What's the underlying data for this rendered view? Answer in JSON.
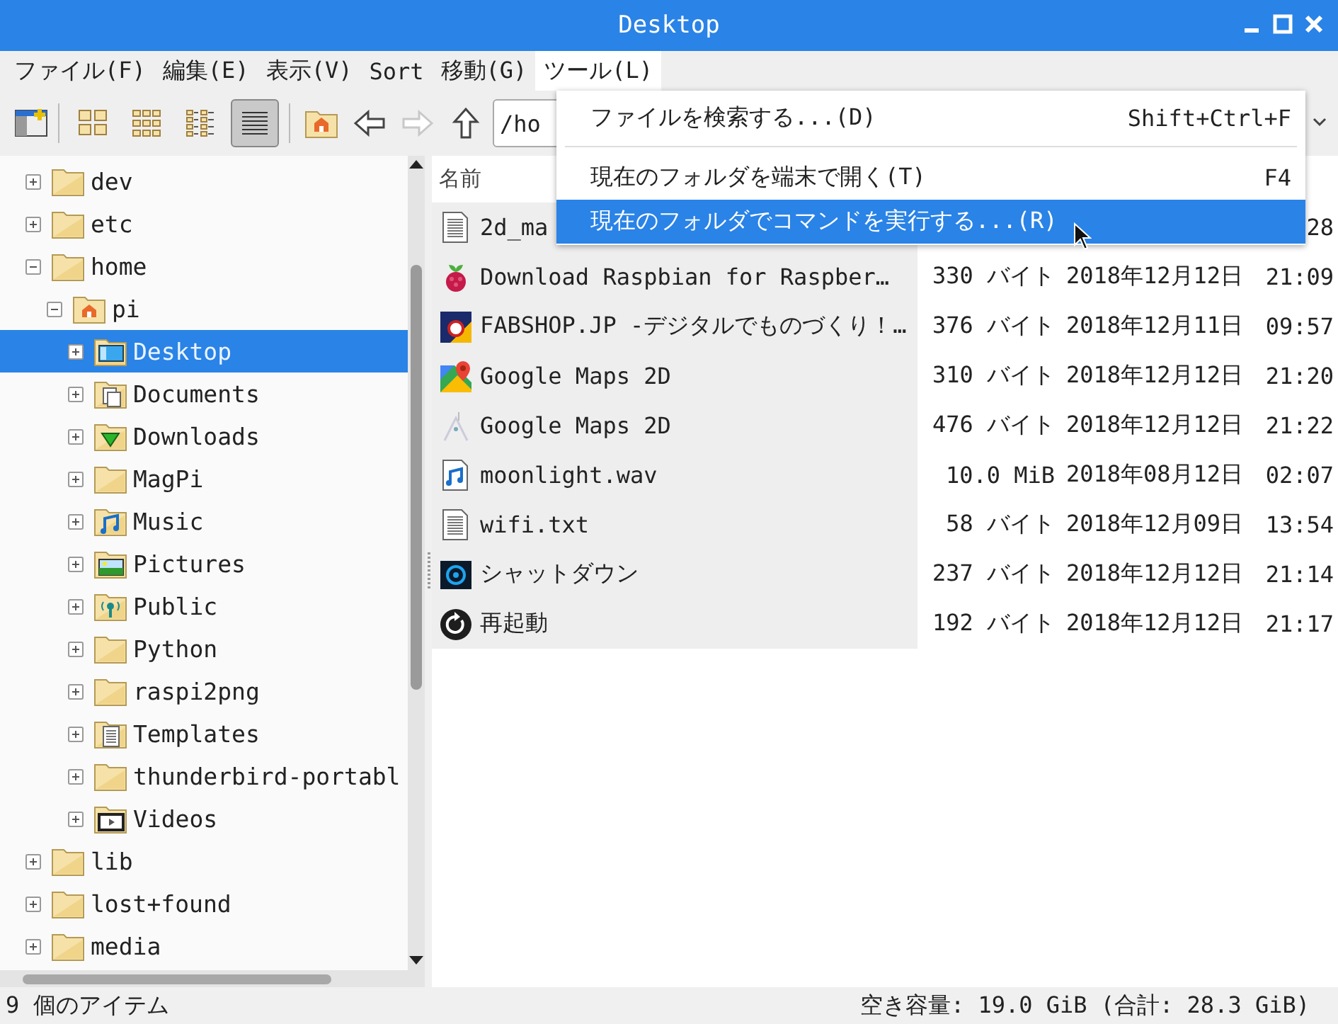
{
  "window": {
    "title": "Desktop"
  },
  "menubar": [
    {
      "label": "ファイル(F)",
      "open": false
    },
    {
      "label": "編集(E)",
      "open": false
    },
    {
      "label": "表示(V)",
      "open": false
    },
    {
      "label": "Sort",
      "open": false
    },
    {
      "label": "移動(G)",
      "open": false
    },
    {
      "label": "ツール(L)",
      "open": true
    }
  ],
  "toolbar": {
    "view_buttons": [
      {
        "kind": "icons",
        "selected": false
      },
      {
        "kind": "thumbnails",
        "selected": false
      },
      {
        "kind": "compact",
        "selected": false
      },
      {
        "kind": "list",
        "selected": true
      }
    ],
    "nav_buttons": [
      {
        "kind": "home",
        "disabled": false
      },
      {
        "kind": "back",
        "disabled": false
      },
      {
        "kind": "forward",
        "disabled": true
      },
      {
        "kind": "up",
        "disabled": false
      }
    ],
    "path": "/ho"
  },
  "sidebar": {
    "tree": [
      {
        "name": "dev",
        "kind": "folder",
        "expanded": false,
        "selected": false
      },
      {
        "name": "etc",
        "kind": "folder",
        "expanded": false,
        "selected": false
      },
      {
        "name": "home",
        "kind": "folder",
        "expanded": true,
        "selected": false,
        "children": [
          {
            "name": "pi",
            "kind": "home",
            "expanded": true,
            "selected": false,
            "children": [
              {
                "name": "Desktop",
                "kind": "desktop",
                "expanded": false,
                "selected": true
              },
              {
                "name": "Documents",
                "kind": "documents",
                "expanded": false,
                "selected": false
              },
              {
                "name": "Downloads",
                "kind": "downloads",
                "expanded": false,
                "selected": false
              },
              {
                "name": "MagPi",
                "kind": "folder",
                "expanded": false,
                "selected": false
              },
              {
                "name": "Music",
                "kind": "music",
                "expanded": false,
                "selected": false
              },
              {
                "name": "Pictures",
                "kind": "pictures",
                "expanded": false,
                "selected": false
              },
              {
                "name": "Public",
                "kind": "public",
                "expanded": false,
                "selected": false
              },
              {
                "name": "Python",
                "kind": "folder",
                "expanded": false,
                "selected": false
              },
              {
                "name": "raspi2png",
                "kind": "folder",
                "expanded": false,
                "selected": false
              },
              {
                "name": "Templates",
                "kind": "templates",
                "expanded": false,
                "selected": false
              },
              {
                "name": "thunderbird-portabl",
                "kind": "folder",
                "expanded": false,
                "selected": false
              },
              {
                "name": "Videos",
                "kind": "videos",
                "expanded": false,
                "selected": false
              }
            ]
          }
        ]
      },
      {
        "name": "lib",
        "kind": "folder",
        "expanded": false,
        "selected": false
      },
      {
        "name": "lost+found",
        "kind": "folder",
        "expanded": false,
        "selected": false
      },
      {
        "name": "media",
        "kind": "folder",
        "expanded": false,
        "selected": false
      }
    ]
  },
  "table": {
    "columns": [
      "名前"
    ],
    "rows": [
      {
        "kind": "text",
        "name": "2d_ma",
        "time": "28"
      },
      {
        "kind": "raspberry",
        "name": "Download Raspbian for Raspber…",
        "size": "330 バイト",
        "date": "2018年12月12日",
        "time": "21:09"
      },
      {
        "kind": "shop",
        "name": "FABSHOP.JP -デジタルでものづくり！…",
        "size": "376 バイト",
        "date": "2018年12月11日",
        "time": "09:57"
      },
      {
        "kind": "map",
        "name": "Google Maps 2D",
        "size": "310 バイト",
        "date": "2018年12月12日",
        "time": "21:20"
      },
      {
        "kind": "faint-map",
        "name": "Google Maps 2D",
        "size": "476 バイト",
        "date": "2018年12月12日",
        "time": "21:22"
      },
      {
        "kind": "audio",
        "name": "moonlight.wav",
        "size": "10.0 MiB",
        "date": "2018年08月12日",
        "time": "02:07"
      },
      {
        "kind": "text",
        "name": "wifi.txt",
        "size": "58 バイト",
        "date": "2018年12月09日",
        "time": "13:54"
      },
      {
        "kind": "power",
        "name": "シャットダウン",
        "size": "237 バイト",
        "date": "2018年12月12日",
        "time": "21:14"
      },
      {
        "kind": "restart",
        "name": "再起動",
        "size": "192 バイト",
        "date": "2018年12月12日",
        "time": "21:17"
      }
    ]
  },
  "menu": [
    {
      "kind": "item",
      "label": "ファイルを検索する...(D)",
      "shortcut": "Shift+Ctrl+F",
      "selected": false
    },
    {
      "kind": "separator"
    },
    {
      "kind": "item",
      "label": "現在のフォルダを端末で開く(T)",
      "shortcut": "F4",
      "selected": false
    },
    {
      "kind": "item",
      "label": "現在のフォルダでコマンドを実行する...(R)",
      "selected": true
    }
  ],
  "status_bar": {
    "items": "9 個のアイテム",
    "space": "空き容量: 19.0 GiB (合計: 28.3 GiB)"
  }
}
